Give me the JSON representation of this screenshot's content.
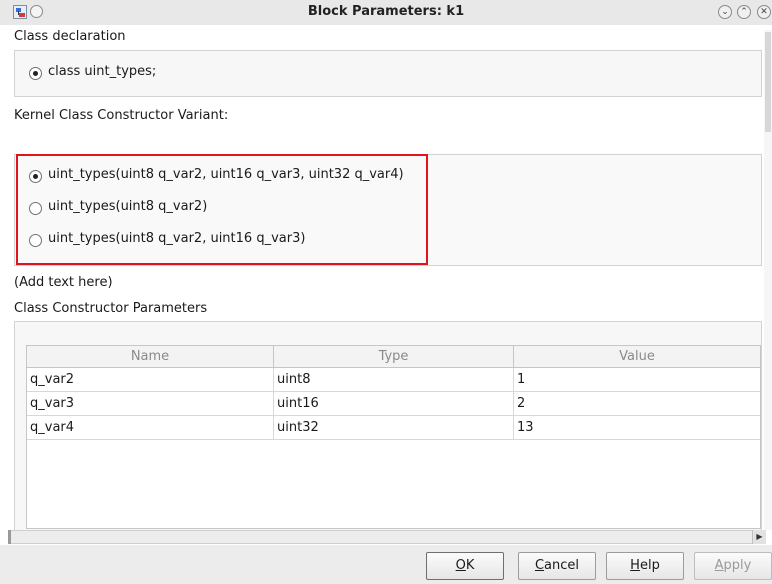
{
  "window": {
    "title": "Block Parameters: k1",
    "controls": [
      "chevron-down-icon",
      "chevron-up-icon",
      "close-icon"
    ]
  },
  "class_declaration": {
    "label": "Class declaration",
    "option": "class uint_types;",
    "selected": true
  },
  "kernel_variant": {
    "label": "Kernel Class Constructor Variant:",
    "options": [
      {
        "label": "uint_types(uint8 q_var2, uint16 q_var3, uint32 q_var4)",
        "selected": true
      },
      {
        "label": "uint_types(uint8 q_var2)",
        "selected": false
      },
      {
        "label": "uint_types(uint8 q_var2, uint16 q_var3)",
        "selected": false
      }
    ],
    "highlight_color": "#e0141e"
  },
  "add_text": "(Add text here)",
  "constructor_params": {
    "label": "Class Constructor Parameters",
    "columns": [
      "Name",
      "Type",
      "Value"
    ],
    "rows": [
      {
        "name": "q_var2",
        "type": "uint8",
        "value": "1"
      },
      {
        "name": "q_var3",
        "type": "uint16",
        "value": "2"
      },
      {
        "name": "q_var4",
        "type": "uint32",
        "value": "13"
      }
    ]
  },
  "buttons": {
    "ok": {
      "mnemonic": "O",
      "rest": "K"
    },
    "cancel": {
      "mnemonic": "C",
      "rest": "ancel"
    },
    "help": {
      "mnemonic": "H",
      "rest": "elp"
    },
    "apply": {
      "mnemonic": "A",
      "rest": "pply",
      "enabled": false
    }
  }
}
